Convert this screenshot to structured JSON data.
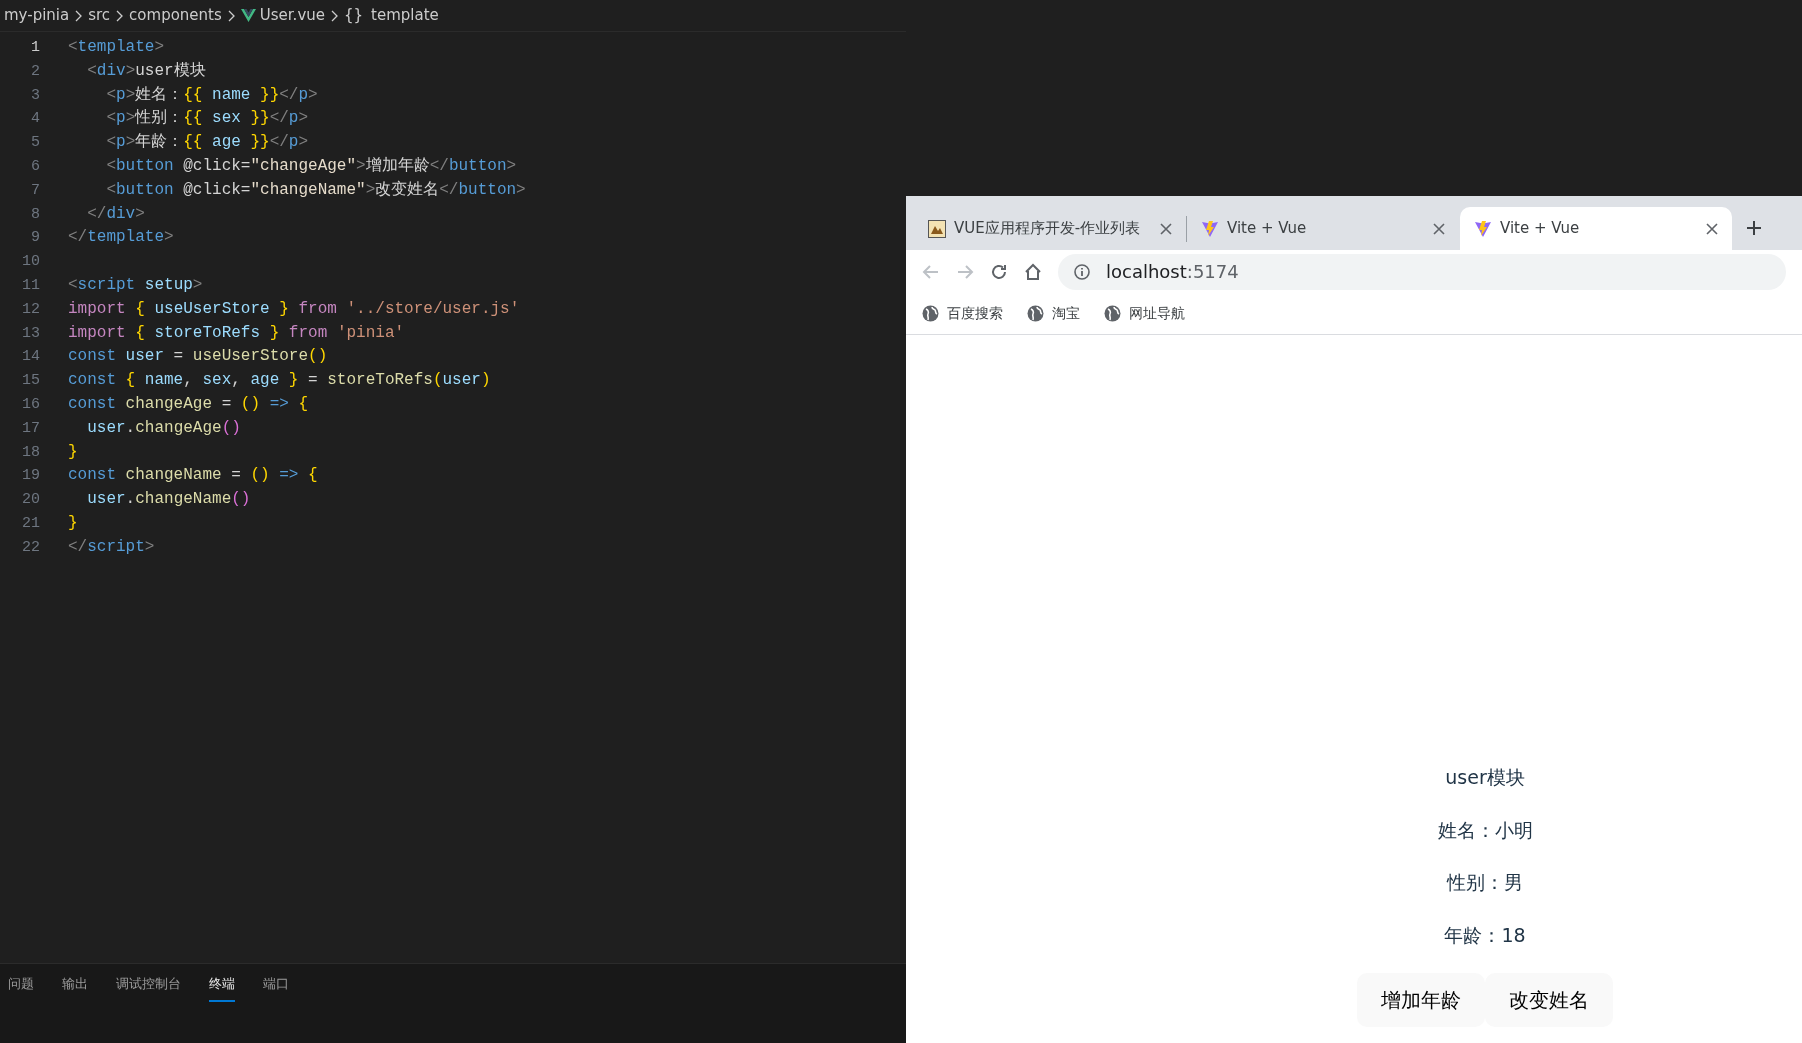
{
  "breadcrumb": [
    {
      "kind": "folder",
      "text": "my-pinia"
    },
    {
      "kind": "folder",
      "text": "src"
    },
    {
      "kind": "folder",
      "text": "components"
    },
    {
      "kind": "vue-file",
      "text": "User.vue"
    },
    {
      "kind": "symbol",
      "symbol": "{}",
      "text": "template"
    }
  ],
  "code": [
    {
      "number": "1",
      "current": true,
      "tokens": [
        {
          "kind": "punct",
          "text": "<"
        },
        {
          "kind": "tag",
          "text": "template"
        },
        {
          "kind": "punct",
          "text": ">"
        }
      ]
    },
    {
      "number": "2",
      "current": false,
      "tokens": [
        {
          "kind": "punct",
          "text": "  <"
        },
        {
          "kind": "tag",
          "text": "div"
        },
        {
          "kind": "punct",
          "text": ">"
        },
        {
          "kind": "text",
          "text": "user模块"
        }
      ]
    },
    {
      "number": "3",
      "current": false,
      "tokens": [
        {
          "kind": "punct",
          "text": "    <"
        },
        {
          "kind": "tag",
          "text": "p"
        },
        {
          "kind": "punct",
          "text": ">"
        },
        {
          "kind": "text",
          "text": "姓名："
        },
        {
          "kind": "brace",
          "text": "{{"
        },
        {
          "kind": "var",
          "text": " name "
        },
        {
          "kind": "brace",
          "text": "}}"
        },
        {
          "kind": "punct",
          "text": "</"
        },
        {
          "kind": "tag",
          "text": "p"
        },
        {
          "kind": "punct",
          "text": ">"
        }
      ]
    },
    {
      "number": "4",
      "current": false,
      "tokens": [
        {
          "kind": "punct",
          "text": "    <"
        },
        {
          "kind": "tag",
          "text": "p"
        },
        {
          "kind": "punct",
          "text": ">"
        },
        {
          "kind": "text",
          "text": "性别："
        },
        {
          "kind": "brace",
          "text": "{{"
        },
        {
          "kind": "var",
          "text": " sex "
        },
        {
          "kind": "brace",
          "text": "}}"
        },
        {
          "kind": "punct",
          "text": "</"
        },
        {
          "kind": "tag",
          "text": "p"
        },
        {
          "kind": "punct",
          "text": ">"
        }
      ]
    },
    {
      "number": "5",
      "current": false,
      "tokens": [
        {
          "kind": "punct",
          "text": "    <"
        },
        {
          "kind": "tag",
          "text": "p"
        },
        {
          "kind": "punct",
          "text": ">"
        },
        {
          "kind": "text",
          "text": "年龄："
        },
        {
          "kind": "brace",
          "text": "{{"
        },
        {
          "kind": "var",
          "text": " age "
        },
        {
          "kind": "brace",
          "text": "}}"
        },
        {
          "kind": "punct",
          "text": "</"
        },
        {
          "kind": "tag",
          "text": "p"
        },
        {
          "kind": "punct",
          "text": ">"
        }
      ]
    },
    {
      "number": "6",
      "current": false,
      "tokens": [
        {
          "kind": "punct",
          "text": "    <"
        },
        {
          "kind": "tag",
          "text": "button"
        },
        {
          "kind": "text",
          "text": " @click="
        },
        {
          "kind": "attrval",
          "text": "\"changeAge\""
        },
        {
          "kind": "punct",
          "text": ">"
        },
        {
          "kind": "text",
          "text": "增加年龄"
        },
        {
          "kind": "punct",
          "text": "</"
        },
        {
          "kind": "tag",
          "text": "button"
        },
        {
          "kind": "punct",
          "text": ">"
        }
      ]
    },
    {
      "number": "7",
      "current": false,
      "tokens": [
        {
          "kind": "punct",
          "text": "    <"
        },
        {
          "kind": "tag",
          "text": "button"
        },
        {
          "kind": "text",
          "text": " @click="
        },
        {
          "kind": "attrval",
          "text": "\"changeName\""
        },
        {
          "kind": "punct",
          "text": ">"
        },
        {
          "kind": "text",
          "text": "改变姓名"
        },
        {
          "kind": "punct",
          "text": "</"
        },
        {
          "kind": "tag",
          "text": "button"
        },
        {
          "kind": "punct",
          "text": ">"
        }
      ]
    },
    {
      "number": "8",
      "current": false,
      "tokens": [
        {
          "kind": "punct",
          "text": "  </"
        },
        {
          "kind": "tag",
          "text": "div"
        },
        {
          "kind": "punct",
          "text": ">"
        }
      ]
    },
    {
      "number": "9",
      "current": false,
      "tokens": [
        {
          "kind": "punct",
          "text": "</"
        },
        {
          "kind": "tag",
          "text": "template"
        },
        {
          "kind": "punct",
          "text": ">"
        }
      ]
    },
    {
      "number": "10",
      "current": false
    },
    {
      "number": "11",
      "current": false,
      "tokens": [
        {
          "kind": "punct",
          "text": "<"
        },
        {
          "kind": "tag",
          "text": "script "
        },
        {
          "kind": "var",
          "text": "setup"
        },
        {
          "kind": "punct",
          "text": ">"
        }
      ]
    },
    {
      "number": "12",
      "current": false,
      "tokens": [
        {
          "kind": "keyword",
          "text": "import "
        },
        {
          "kind": "brace",
          "text": "{"
        },
        {
          "kind": "var",
          "text": " useUserStore "
        },
        {
          "kind": "brace",
          "text": "} "
        },
        {
          "kind": "keyword",
          "text": "from "
        },
        {
          "kind": "string",
          "text": "'../store/user.js'"
        }
      ]
    },
    {
      "number": "13",
      "current": false,
      "tokens": [
        {
          "kind": "keyword",
          "text": "import "
        },
        {
          "kind": "brace",
          "text": "{"
        },
        {
          "kind": "var",
          "text": " storeToRefs "
        },
        {
          "kind": "brace",
          "text": "} "
        },
        {
          "kind": "keyword",
          "text": "from "
        },
        {
          "kind": "string",
          "text": "'pinia'"
        }
      ]
    },
    {
      "number": "14",
      "current": false,
      "tokens": [
        {
          "kind": "decl",
          "text": "const "
        },
        {
          "kind": "var",
          "text": "user"
        },
        {
          "kind": "text",
          "text": " = "
        },
        {
          "kind": "func",
          "text": "useUserStore"
        },
        {
          "kind": "brace",
          "text": "()"
        }
      ]
    },
    {
      "number": "15",
      "current": false,
      "tokens": [
        {
          "kind": "decl",
          "text": "const "
        },
        {
          "kind": "brace",
          "text": "{ "
        },
        {
          "kind": "var",
          "text": "name"
        },
        {
          "kind": "text",
          "text": ", "
        },
        {
          "kind": "var",
          "text": "sex"
        },
        {
          "kind": "text",
          "text": ", "
        },
        {
          "kind": "var",
          "text": "age "
        },
        {
          "kind": "brace",
          "text": "}"
        },
        {
          "kind": "text",
          "text": " = "
        },
        {
          "kind": "func",
          "text": "storeToRefs"
        },
        {
          "kind": "brace",
          "text": "("
        },
        {
          "kind": "var",
          "text": "user"
        },
        {
          "kind": "brace",
          "text": ")"
        }
      ]
    },
    {
      "number": "16",
      "current": false,
      "tokens": [
        {
          "kind": "decl",
          "text": "const "
        },
        {
          "kind": "func",
          "text": "changeAge"
        },
        {
          "kind": "text",
          "text": " = "
        },
        {
          "kind": "brace",
          "text": "() "
        },
        {
          "kind": "decl",
          "text": "=> "
        },
        {
          "kind": "brace",
          "text": "{"
        }
      ]
    },
    {
      "number": "17",
      "current": false,
      "tokens": [
        {
          "kind": "var",
          "text": "  user"
        },
        {
          "kind": "text",
          "text": "."
        },
        {
          "kind": "func",
          "text": "changeAge"
        },
        {
          "kind": "paren",
          "text": "()"
        }
      ]
    },
    {
      "number": "18",
      "current": false,
      "tokens": [
        {
          "kind": "brace",
          "text": "}"
        }
      ]
    },
    {
      "number": "19",
      "current": false,
      "tokens": [
        {
          "kind": "decl",
          "text": "const "
        },
        {
          "kind": "func",
          "text": "changeName"
        },
        {
          "kind": "text",
          "text": " = "
        },
        {
          "kind": "brace",
          "text": "() "
        },
        {
          "kind": "decl",
          "text": "=> "
        },
        {
          "kind": "brace",
          "text": "{"
        }
      ]
    },
    {
      "number": "20",
      "current": false,
      "tokens": [
        {
          "kind": "var",
          "text": "  user"
        },
        {
          "kind": "text",
          "text": "."
        },
        {
          "kind": "func",
          "text": "changeName"
        },
        {
          "kind": "paren",
          "text": "()"
        }
      ]
    },
    {
      "number": "21",
      "current": false,
      "tokens": [
        {
          "kind": "brace",
          "text": "}"
        }
      ]
    },
    {
      "number": "22",
      "current": false,
      "tokens": [
        {
          "kind": "punct",
          "text": "</"
        },
        {
          "kind": "tag",
          "text": "script"
        },
        {
          "kind": "punct",
          "text": ">"
        }
      ]
    }
  ],
  "panel_tabs": [
    {
      "label": "问题",
      "selected": false
    },
    {
      "label": "输出",
      "selected": false
    },
    {
      "label": "调试控制台",
      "selected": false
    },
    {
      "label": "终端",
      "selected": true
    },
    {
      "label": "端口",
      "selected": false
    }
  ],
  "browser": {
    "tabs": [
      {
        "kind": "picture",
        "title": "VUE应用程序开发-作业列表",
        "selected": false
      },
      {
        "kind": "bolt",
        "title": "Vite + Vue",
        "selected": false
      },
      {
        "kind": "bolt",
        "title": "Vite + Vue",
        "selected": true
      }
    ],
    "address": {
      "host": "localhost",
      "port": ":5174"
    },
    "bookmarks": [
      "百度搜索",
      "淘宝",
      "网址导航"
    ],
    "page": {
      "heading": "user模块",
      "lines": [
        "姓名：小明",
        "性别：男",
        "年龄：18"
      ],
      "buttons": [
        "增加年龄",
        "改变姓名"
      ]
    }
  }
}
